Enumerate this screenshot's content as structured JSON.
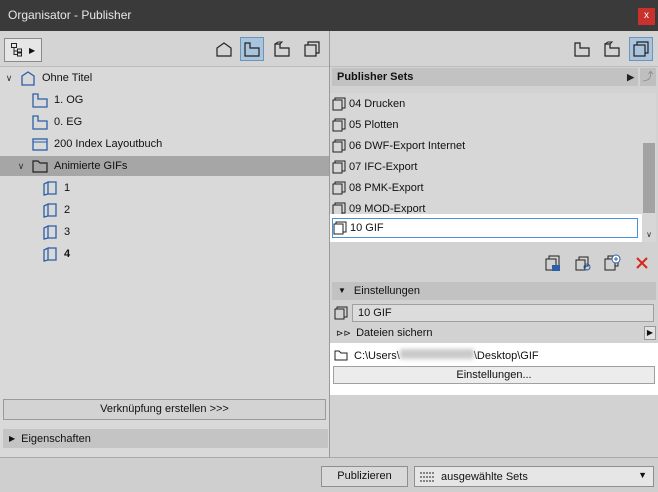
{
  "window": {
    "title": "Organisator - Publisher",
    "close_label": "x"
  },
  "left": {
    "tree": [
      {
        "label": "Ohne Titel",
        "icon": "project-icon",
        "caret": "∨"
      },
      {
        "label": "1. OG",
        "icon": "story-icon"
      },
      {
        "label": "0. EG",
        "icon": "story-icon"
      },
      {
        "label": "200 Index Layoutbuch",
        "icon": "layout-icon"
      },
      {
        "label": "Animierte GIFs",
        "icon": "folder-icon",
        "caret": "∨"
      },
      {
        "label": "1",
        "icon": "view-icon"
      },
      {
        "label": "2",
        "icon": "view-icon"
      },
      {
        "label": "3",
        "icon": "view-icon"
      },
      {
        "label": "4",
        "icon": "view-icon"
      }
    ],
    "link_button": "Verknüpfung erstellen >>>",
    "properties_label": "Eigenschaften"
  },
  "right": {
    "sets_header": "Publisher Sets",
    "sets": [
      "04 Drucken",
      "05 Plotten",
      "06 DWF-Export Internet",
      "07 IFC-Export",
      "08 PMK-Export",
      "09 MOD-Export",
      "10 GIF"
    ],
    "selected_set": "10 GIF",
    "settings_header": "Einstellungen",
    "settings_name": "10 GIF",
    "save_files_label": "Dateien sichern",
    "path_prefix": "C:\\Users\\",
    "path_suffix": "\\Desktop\\GIF",
    "settings_button": "Einstellungen..."
  },
  "bottom": {
    "publish_button": "Publizieren",
    "selection": "ausgewählte Sets"
  },
  "colors": {
    "accent": "#a9c4dd",
    "close": "#c8312c",
    "delete": "#d9261c",
    "icon": "#2b5fa8"
  }
}
